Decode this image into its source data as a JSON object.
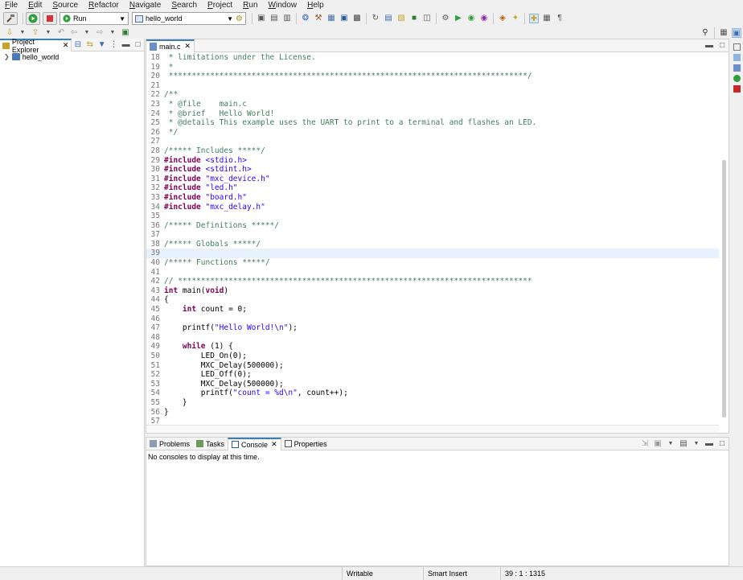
{
  "menu": [
    "File",
    "Edit",
    "Source",
    "Refactor",
    "Navigate",
    "Search",
    "Project",
    "Run",
    "Window",
    "Help"
  ],
  "toolbar": {
    "launch_mode": "Run",
    "launch_config": "hello_world"
  },
  "explorer": {
    "tab_label": "Project Explorer",
    "project": "hello_world"
  },
  "editor": {
    "tab_label": "main.c",
    "current_line": "39",
    "lines": [
      {
        "n": "18",
        "segs": [
          {
            "t": " * limitations under the License.",
            "c": "cmt"
          }
        ]
      },
      {
        "n": "19",
        "segs": [
          {
            "t": " *",
            "c": "cmt"
          }
        ]
      },
      {
        "n": "20",
        "segs": [
          {
            "t": " ******************************************************************************/",
            "c": "cmt"
          }
        ]
      },
      {
        "n": "21",
        "segs": []
      },
      {
        "n": "22",
        "segs": [
          {
            "t": "/**",
            "c": "cmt"
          }
        ]
      },
      {
        "n": "23",
        "segs": [
          {
            "t": " * @file    main.c",
            "c": "cmt"
          }
        ]
      },
      {
        "n": "24",
        "segs": [
          {
            "t": " * @brief   Hello World!",
            "c": "cmt"
          }
        ]
      },
      {
        "n": "25",
        "segs": [
          {
            "t": " * @details This example uses the UART to print to a terminal and flashes an LED.",
            "c": "cmt"
          }
        ]
      },
      {
        "n": "26",
        "segs": [
          {
            "t": " */",
            "c": "cmt"
          }
        ]
      },
      {
        "n": "27",
        "segs": []
      },
      {
        "n": "28",
        "segs": [
          {
            "t": "/***** Includes *****/",
            "c": "cmt"
          }
        ]
      },
      {
        "n": "29",
        "segs": [
          {
            "t": "#include",
            "c": "kw"
          },
          {
            "t": " <stdio.h>",
            "c": "str"
          }
        ]
      },
      {
        "n": "30",
        "segs": [
          {
            "t": "#include",
            "c": "kw"
          },
          {
            "t": " <stdint.h>",
            "c": "str"
          }
        ]
      },
      {
        "n": "31",
        "segs": [
          {
            "t": "#include",
            "c": "kw"
          },
          {
            "t": " \"mxc_device.h\"",
            "c": "str"
          }
        ]
      },
      {
        "n": "32",
        "segs": [
          {
            "t": "#include",
            "c": "kw"
          },
          {
            "t": " \"led.h\"",
            "c": "str"
          }
        ]
      },
      {
        "n": "33",
        "segs": [
          {
            "t": "#include",
            "c": "kw"
          },
          {
            "t": " \"board.h\"",
            "c": "str"
          }
        ]
      },
      {
        "n": "34",
        "segs": [
          {
            "t": "#include",
            "c": "kw"
          },
          {
            "t": " \"mxc_delay.h\"",
            "c": "str"
          }
        ]
      },
      {
        "n": "35",
        "segs": []
      },
      {
        "n": "36",
        "segs": [
          {
            "t": "/***** Definitions *****/",
            "c": "cmt"
          }
        ]
      },
      {
        "n": "37",
        "segs": []
      },
      {
        "n": "38",
        "segs": [
          {
            "t": "/***** Globals *****/",
            "c": "cmt"
          }
        ]
      },
      {
        "n": "39",
        "segs": []
      },
      {
        "n": "40",
        "segs": [
          {
            "t": "/***** Functions *****/",
            "c": "cmt"
          }
        ]
      },
      {
        "n": "41",
        "segs": []
      },
      {
        "n": "42",
        "segs": [
          {
            "t": "// *****************************************************************************",
            "c": "cmt"
          }
        ]
      },
      {
        "n": "43",
        "segs": [
          {
            "t": "int",
            "c": "kw"
          },
          {
            "t": " main(",
            "c": "txt"
          },
          {
            "t": "void",
            "c": "kw"
          },
          {
            "t": ")",
            "c": "txt"
          }
        ]
      },
      {
        "n": "44",
        "segs": [
          {
            "t": "{",
            "c": "txt"
          }
        ]
      },
      {
        "n": "45",
        "segs": [
          {
            "t": "    ",
            "c": "txt"
          },
          {
            "t": "int",
            "c": "kw"
          },
          {
            "t": " count = 0;",
            "c": "txt"
          }
        ]
      },
      {
        "n": "46",
        "segs": []
      },
      {
        "n": "47",
        "segs": [
          {
            "t": "    printf(",
            "c": "txt"
          },
          {
            "t": "\"Hello World!\\n\"",
            "c": "str"
          },
          {
            "t": ");",
            "c": "txt"
          }
        ]
      },
      {
        "n": "48",
        "segs": []
      },
      {
        "n": "49",
        "segs": [
          {
            "t": "    ",
            "c": "txt"
          },
          {
            "t": "while",
            "c": "kw"
          },
          {
            "t": " (1) {",
            "c": "txt"
          }
        ]
      },
      {
        "n": "50",
        "segs": [
          {
            "t": "        LED_On(0);",
            "c": "txt"
          }
        ]
      },
      {
        "n": "51",
        "segs": [
          {
            "t": "        MXC_Delay(500000);",
            "c": "txt"
          }
        ]
      },
      {
        "n": "52",
        "segs": [
          {
            "t": "        LED_Off(0);",
            "c": "txt"
          }
        ]
      },
      {
        "n": "53",
        "segs": [
          {
            "t": "        MXC_Delay(500000);",
            "c": "txt"
          }
        ]
      },
      {
        "n": "54",
        "segs": [
          {
            "t": "        printf(",
            "c": "txt"
          },
          {
            "t": "\"count = %d\\n\"",
            "c": "str"
          },
          {
            "t": ", count++);",
            "c": "txt"
          }
        ]
      },
      {
        "n": "55",
        "segs": [
          {
            "t": "    }",
            "c": "txt"
          }
        ]
      },
      {
        "n": "56",
        "segs": [
          {
            "t": "}",
            "c": "txt"
          }
        ]
      },
      {
        "n": "57",
        "segs": []
      }
    ]
  },
  "bottom_panel": {
    "tabs": [
      "Problems",
      "Tasks",
      "Console",
      "Properties"
    ],
    "active_tab": "Console",
    "message": "No consoles to display at this time."
  },
  "status": {
    "mode": "Writable",
    "insert": "Smart Insert",
    "position": "39 : 1 : 1315"
  },
  "colors": {
    "accent": "#3c7fb1",
    "keyword": "#7f0055",
    "comment": "#3f7f5f",
    "string": "#2a00ff",
    "current_line": "#e8f2fe"
  }
}
